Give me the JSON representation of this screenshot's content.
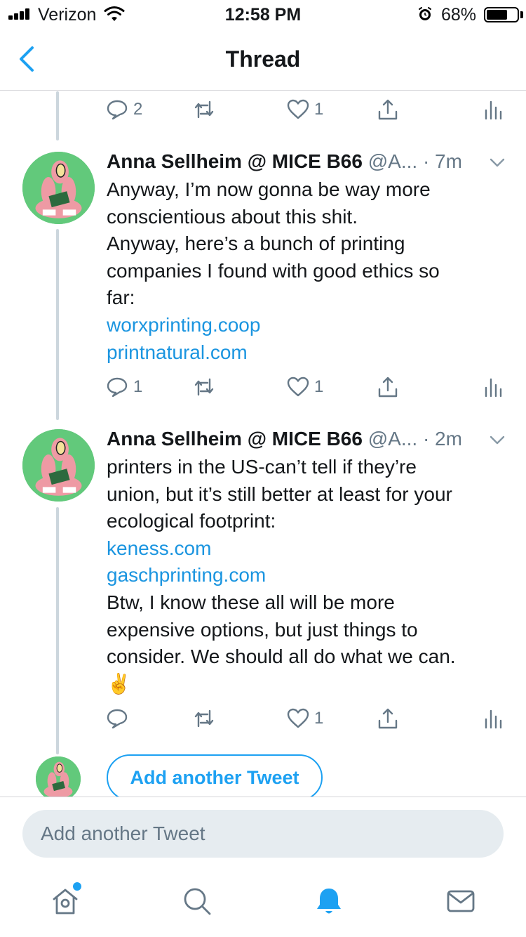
{
  "status_bar": {
    "carrier": "Verizon",
    "time": "12:58 PM",
    "battery_percent": "68%",
    "battery_level": 0.68
  },
  "nav": {
    "title": "Thread",
    "back_icon": "chevron-left-icon"
  },
  "top_actions": {
    "reply_count": "2",
    "like_count": "1"
  },
  "tweets": [
    {
      "name": "Anna Sellheim @ MICE B66",
      "handle": "@A...",
      "time": "· 7m",
      "lines": [
        "Anyway, I’m now gonna be way more",
        "conscientious about this shit.",
        "Anyway, here’s a bunch of printing",
        "companies I found with good ethics so",
        "far:"
      ],
      "links": [
        "worxprinting.coop",
        "printnatural.com"
      ],
      "reply_count": "1",
      "like_count": "1"
    },
    {
      "name": "Anna Sellheim @ MICE B66",
      "handle": "@A...",
      "time": "· 2m",
      "lines": [
        "printers in the US-can’t tell if they’re",
        "union, but it’s still better at least for your",
        "ecological footprint:"
      ],
      "links": [
        "keness.com",
        "gaschprinting.com"
      ],
      "lines_after": [
        "Btw, I know these all will be more",
        "expensive options, but just things to",
        "consider. We should all do what we can.",
        "✌️"
      ],
      "reply_count": "",
      "like_count": "1"
    }
  ],
  "add_tweet_button": "Add another Tweet",
  "compose": {
    "placeholder": "Add another Tweet"
  },
  "tabs": [
    "home-icon",
    "search-icon",
    "notifications-icon",
    "messages-icon"
  ],
  "colors": {
    "accent": "#1da1f2",
    "link": "#1b95e0",
    "secondary_text": "#657786",
    "thread_line": "#ccd6dd"
  }
}
